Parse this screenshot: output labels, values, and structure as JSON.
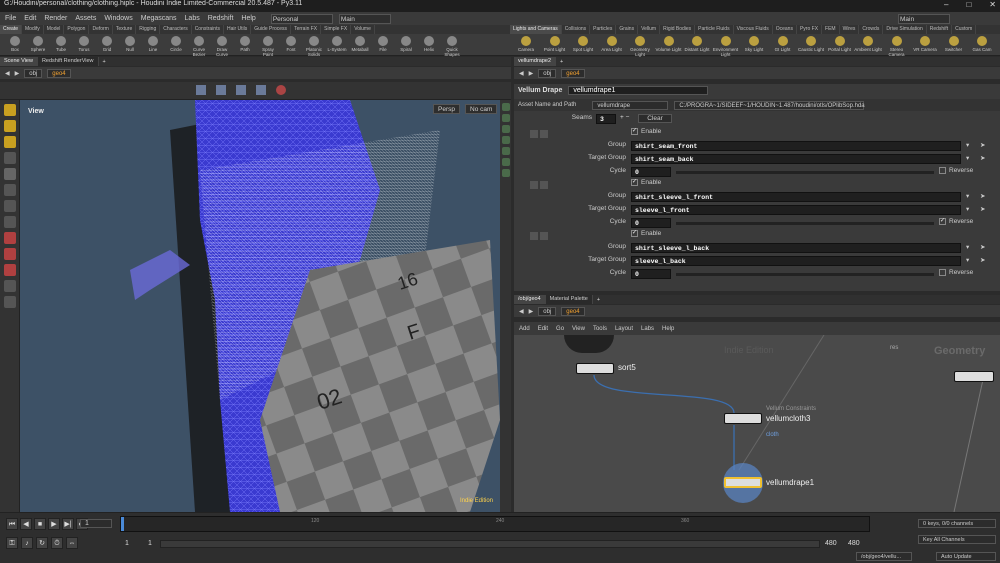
{
  "window": {
    "title": "G:/Houdini/personal/clothing/clothing.hiplc - Houdini Indie Limited-Commercial 20.5.487 - Py3.11"
  },
  "menu": {
    "items": [
      "File",
      "Edit",
      "Render",
      "Assets",
      "Windows",
      "Megascans",
      "Labs",
      "Redshift",
      "Help"
    ],
    "desktop": "Personal",
    "main": "Main",
    "right_main": "Main"
  },
  "shelf_tabs_left": [
    "Create",
    "Modify",
    "Model",
    "Polygon",
    "Deform",
    "Texture",
    "Rigging",
    "Characters",
    "Constraints",
    "Hair Utils",
    "Guide Process",
    "Terrain FX",
    "Simple FX",
    "Volume"
  ],
  "shelf_tabs_right": [
    "Lights and Cameras",
    "Collisions",
    "Particles",
    "Grains",
    "Vellum",
    "Rigid Bodies",
    "Particle Fluids",
    "Viscous Fluids",
    "Oceans",
    "Pyro FX",
    "FEM",
    "Wires",
    "Crowds",
    "Drive Simulation",
    "Redshift",
    "Custom"
  ],
  "shelf_tools_left": [
    "Box",
    "Sphere",
    "Tube",
    "Torus",
    "Grid",
    "Null",
    "Line",
    "Circle",
    "Curve Bezier",
    "Draw Curve",
    "Path",
    "Spray Paint",
    "Font",
    "Platonic Solids",
    "L-System",
    "Metaball",
    "File",
    "Spiral",
    "Helix",
    "Quick Shapes"
  ],
  "shelf_tools_right": [
    "Camera",
    "Point Light",
    "Spot Light",
    "Area Light",
    "Geometry Light",
    "Volume Light",
    "Distant Light",
    "Environment Light",
    "Sky Light",
    "GI Light",
    "Caustic Light",
    "Portal Light",
    "Ambient Light",
    "Stereo Camera",
    "VR Camera",
    "Switcher",
    "Gas Cam"
  ],
  "left_pane": {
    "tabs": [
      "Scene View",
      "Redshift RenderView"
    ],
    "path": [
      "obj",
      "geo4"
    ],
    "view_label": "View",
    "persp": "Persp",
    "cam": "No cam",
    "edition": "Indie Edition"
  },
  "right_pane": {
    "tab": "vellumdrape2",
    "path": [
      "obj",
      "geo4"
    ]
  },
  "params": {
    "node_type": "Vellum Drape",
    "node_name": "vellumdrape1",
    "asset_label": "Asset Name and Path",
    "asset_name": "vellumdrape",
    "asset_path": "C:/PROGRA~1/SIDEEF~1/HOUDIN~1.487/houdini/otls/OPlibSop.hda",
    "seams_label": "Seams",
    "seams_value": "3",
    "clear_label": "Clear",
    "enable_label": "Enable",
    "group_label": "Group",
    "target_label": "Target Group",
    "cycle_label": "Cycle",
    "reverse_label": "Reverse",
    "seams": [
      {
        "group": "shirt_seam_front",
        "target": "shirt_seam_back",
        "cycle": "0",
        "reverse": false
      },
      {
        "group": "shirt_sleeve_l_front",
        "target": "sleeve_l_front",
        "cycle": "0",
        "reverse": true
      },
      {
        "group": "shirt_sleeve_l_back",
        "target": "sleeve_l_back",
        "cycle": "0",
        "reverse": false
      }
    ]
  },
  "network": {
    "tabs": [
      "/obj/geo4",
      "Material Palette"
    ],
    "path": [
      "obj",
      "geo4"
    ],
    "menu": [
      "Add",
      "Edit",
      "Go",
      "View",
      "Tools",
      "Layout",
      "Labs",
      "Help"
    ],
    "watermark": "Indie Edition",
    "geometry_label": "Geometry",
    "nodes": {
      "sort": "sort5",
      "constraints_caption": "Vellum Constraints",
      "cloth": "vellumcloth3",
      "cloth_sub": "cloth",
      "drape": "vellumdrape1",
      "res": "res"
    }
  },
  "timeline": {
    "frame": "1",
    "ticks": [
      "120",
      "240",
      "360"
    ],
    "start": "1",
    "start2": "1",
    "end": "480",
    "end2": "480",
    "keys": "0 keys, 0/0 channels",
    "key_all": "Key All Channels",
    "status_path": "/obj/geo4/vellu...",
    "auto_update": "Auto Update"
  },
  "colors": {
    "accent": "#f0a030",
    "wire": "#5a5ce8",
    "viewport_bg": "#3d5166"
  }
}
